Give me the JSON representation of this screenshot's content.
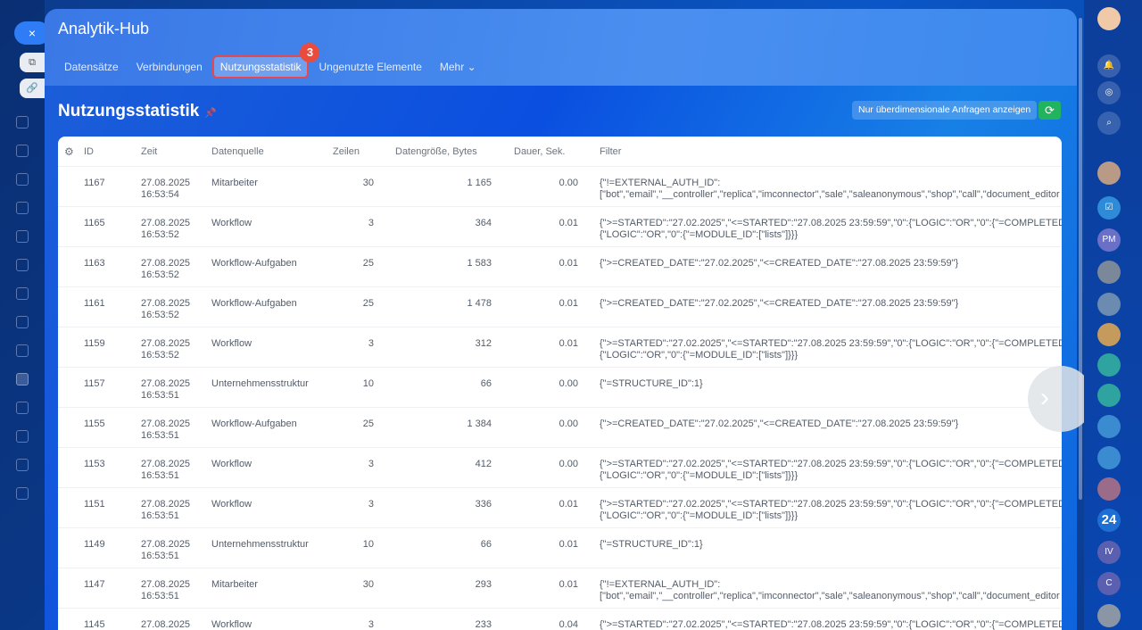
{
  "app": {
    "title": "Analytik-Hub",
    "close": "×"
  },
  "tabs": [
    {
      "label": "Datensätze"
    },
    {
      "label": "Verbindungen"
    },
    {
      "label": "Nutzungsstatistik",
      "badge": "3"
    },
    {
      "label": "Ungenutzte Elemente"
    },
    {
      "label": "Mehr ⌄"
    }
  ],
  "page": {
    "title": "Nutzungsstatistik",
    "pin": "📌",
    "oversize_button": "Nur überdimensionale Anfragen anzeigen",
    "refresh": "⟳"
  },
  "table": {
    "headers": [
      "ID",
      "Zeit",
      "Datenquelle",
      "Zeilen",
      "Datengröße, Bytes",
      "Dauer, Sek.",
      "Filter"
    ],
    "rows": [
      {
        "id": "1167",
        "date": "27.08.2025",
        "time": "16:53:54",
        "source": "Mitarbeiter",
        "rows": "30",
        "bytes": "1 165",
        "dur": "0.00",
        "f1": "{\"!=EXTERNAL_AUTH_ID\":",
        "f2": "[\"bot\",\"email\",\"__controller\",\"replica\",\"imconnector\",\"sale\",\"saleanonymous\",\"shop\",\"call\",\"document_editor"
      },
      {
        "id": "1165",
        "date": "27.08.2025",
        "time": "16:53:52",
        "source": "Workflow",
        "rows": "3",
        "bytes": "364",
        "dur": "0.01",
        "f1": "{\">=STARTED\":\"27.02.2025\",\"<=STARTED\":\"27.08.2025 23:59:59\",\"0\":{\"LOGIC\":\"OR\",\"0\":{\"=COMPLETED",
        "f2": "{\"LOGIC\":\"OR\",\"0\":{\"=MODULE_ID\":[\"lists\"]}}}"
      },
      {
        "id": "1163",
        "date": "27.08.2025",
        "time": "16:53:52",
        "source": "Workflow-Aufgaben",
        "rows": "25",
        "bytes": "1 583",
        "dur": "0.01",
        "f1": "{\">=CREATED_DATE\":\"27.02.2025\",\"<=CREATED_DATE\":\"27.08.2025 23:59:59\"}",
        "f2": ""
      },
      {
        "id": "1161",
        "date": "27.08.2025",
        "time": "16:53:52",
        "source": "Workflow-Aufgaben",
        "rows": "25",
        "bytes": "1 478",
        "dur": "0.01",
        "f1": "{\">=CREATED_DATE\":\"27.02.2025\",\"<=CREATED_DATE\":\"27.08.2025 23:59:59\"}",
        "f2": ""
      },
      {
        "id": "1159",
        "date": "27.08.2025",
        "time": "16:53:52",
        "source": "Workflow",
        "rows": "3",
        "bytes": "312",
        "dur": "0.01",
        "f1": "{\">=STARTED\":\"27.02.2025\",\"<=STARTED\":\"27.08.2025 23:59:59\",\"0\":{\"LOGIC\":\"OR\",\"0\":{\"=COMPLETED",
        "f2": "{\"LOGIC\":\"OR\",\"0\":{\"=MODULE_ID\":[\"lists\"]}}}"
      },
      {
        "id": "1157",
        "date": "27.08.2025",
        "time": "16:53:51",
        "source": "Unternehmensstruktur",
        "rows": "10",
        "bytes": "66",
        "dur": "0.00",
        "f1": "{\"=STRUCTURE_ID\":1}",
        "f2": ""
      },
      {
        "id": "1155",
        "date": "27.08.2025",
        "time": "16:53:51",
        "source": "Workflow-Aufgaben",
        "rows": "25",
        "bytes": "1 384",
        "dur": "0.00",
        "f1": "{\">=CREATED_DATE\":\"27.02.2025\",\"<=CREATED_DATE\":\"27.08.2025 23:59:59\"}",
        "f2": ""
      },
      {
        "id": "1153",
        "date": "27.08.2025",
        "time": "16:53:51",
        "source": "Workflow",
        "rows": "3",
        "bytes": "412",
        "dur": "0.00",
        "f1": "{\">=STARTED\":\"27.02.2025\",\"<=STARTED\":\"27.08.2025 23:59:59\",\"0\":{\"LOGIC\":\"OR\",\"0\":{\"=COMPLETED",
        "f2": "{\"LOGIC\":\"OR\",\"0\":{\"=MODULE_ID\":[\"lists\"]}}}"
      },
      {
        "id": "1151",
        "date": "27.08.2025",
        "time": "16:53:51",
        "source": "Workflow",
        "rows": "3",
        "bytes": "336",
        "dur": "0.01",
        "f1": "{\">=STARTED\":\"27.02.2025\",\"<=STARTED\":\"27.08.2025 23:59:59\",\"0\":{\"LOGIC\":\"OR\",\"0\":{\"=COMPLETED",
        "f2": "{\"LOGIC\":\"OR\",\"0\":{\"=MODULE_ID\":[\"lists\"]}}}"
      },
      {
        "id": "1149",
        "date": "27.08.2025",
        "time": "16:53:51",
        "source": "Unternehmensstruktur",
        "rows": "10",
        "bytes": "66",
        "dur": "0.01",
        "f1": "{\"=STRUCTURE_ID\":1}",
        "f2": ""
      },
      {
        "id": "1147",
        "date": "27.08.2025",
        "time": "16:53:51",
        "source": "Mitarbeiter",
        "rows": "30",
        "bytes": "293",
        "dur": "0.01",
        "f1": "{\"!=EXTERNAL_AUTH_ID\":",
        "f2": "[\"bot\",\"email\",\"__controller\",\"replica\",\"imconnector\",\"sale\",\"saleanonymous\",\"shop\",\"call\",\"document_editor"
      },
      {
        "id": "1145",
        "date": "27.08.2025",
        "time": "",
        "source": "Workflow",
        "rows": "3",
        "bytes": "233",
        "dur": "0.04",
        "f1": "{\">=STARTED\":\"27.02.2025\",\"<=STARTED\":\"27.08.2025 23:59:59\",\"0\":{\"LOGIC\":\"OR\",\"0\":{\"=COMPLETED",
        "f2": ""
      }
    ]
  },
  "rightbar": {
    "items": [
      "PM",
      "24",
      "IV",
      "C"
    ]
  }
}
